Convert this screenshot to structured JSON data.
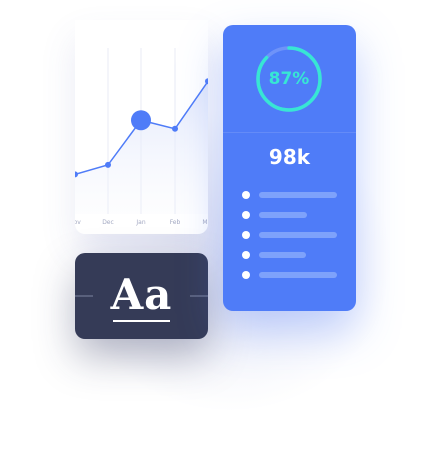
{
  "colors": {
    "accent": "#4f7cf8",
    "teal": "#37e6d4",
    "dark_card": "#353b57",
    "gridline": "#e8ebf5",
    "line": "#4f7cf8"
  },
  "chart": {
    "tick_labels": [
      "Nov",
      "Dec",
      "Jan",
      "Feb",
      "Mar"
    ],
    "values": [
      48,
      58,
      105,
      96,
      146
    ],
    "highlight_index": 2,
    "y_range": [
      0,
      200
    ]
  },
  "typeface": {
    "sample": "Aa"
  },
  "stats": {
    "gauge_label": "87%",
    "gauge_value": 0.87,
    "headline": "98k",
    "list_icons": [
      "bullet-dot",
      "bullet-dot",
      "bullet-dot",
      "bullet-dot",
      "bullet-dot"
    ],
    "list_fill": [
      1.0,
      0.62,
      1.0,
      0.6,
      1.0
    ]
  }
}
